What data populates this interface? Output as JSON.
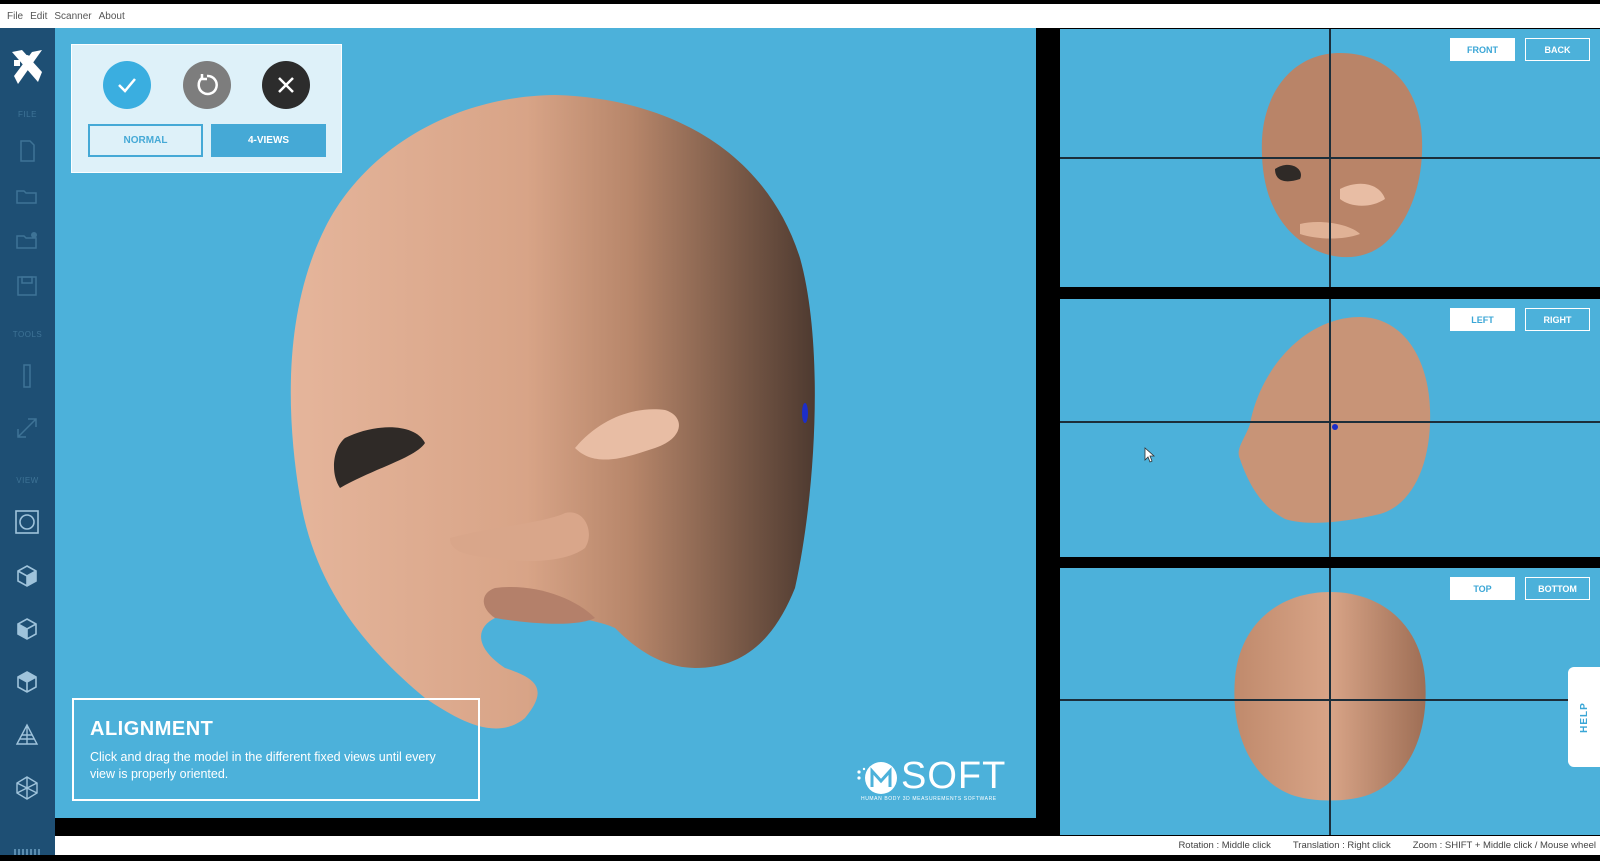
{
  "menubar": {
    "items": [
      "File",
      "Edit",
      "Scanner",
      "About"
    ]
  },
  "sidebar": {
    "sections": {
      "file": "FILE",
      "tools": "TOOLS",
      "view": "VIEW"
    },
    "icons": [
      "new-file-icon",
      "open-folder-icon",
      "import-folder-icon",
      "save-icon",
      "measure-tool-icon",
      "resize-tool-icon",
      "view-orbit-icon",
      "cube-front-icon",
      "cube-side-icon",
      "cube-top-icon",
      "wireframe-icon",
      "mesh-icon"
    ]
  },
  "mode_panel": {
    "normal_label": "NORMAL",
    "four_views_label": "4-VIEWS"
  },
  "alignment": {
    "title": "ALIGNMENT",
    "description": "Click and drag the model in the different fixed views until every view is properly oriented."
  },
  "brand": {
    "name": "SOFT",
    "tagline": "HUMAN BODY 3D MEASUREMENTS SOFTWARE"
  },
  "views": {
    "front": {
      "primary": "FRONT",
      "secondary": "BACK"
    },
    "left": {
      "primary": "LEFT",
      "secondary": "RIGHT"
    },
    "top": {
      "primary": "TOP",
      "secondary": "BOTTOM"
    }
  },
  "help_label": "HELP",
  "status": {
    "rotation": "Rotation : Middle click",
    "translation": "Translation : Right click",
    "zoom": "Zoom : SHIFT + Middle click / Mouse wheel"
  },
  "colors": {
    "viewport": "#4cb1da",
    "sidebar": "#1e4f74",
    "accent": "#45a9d6",
    "skin": "#c89477"
  }
}
